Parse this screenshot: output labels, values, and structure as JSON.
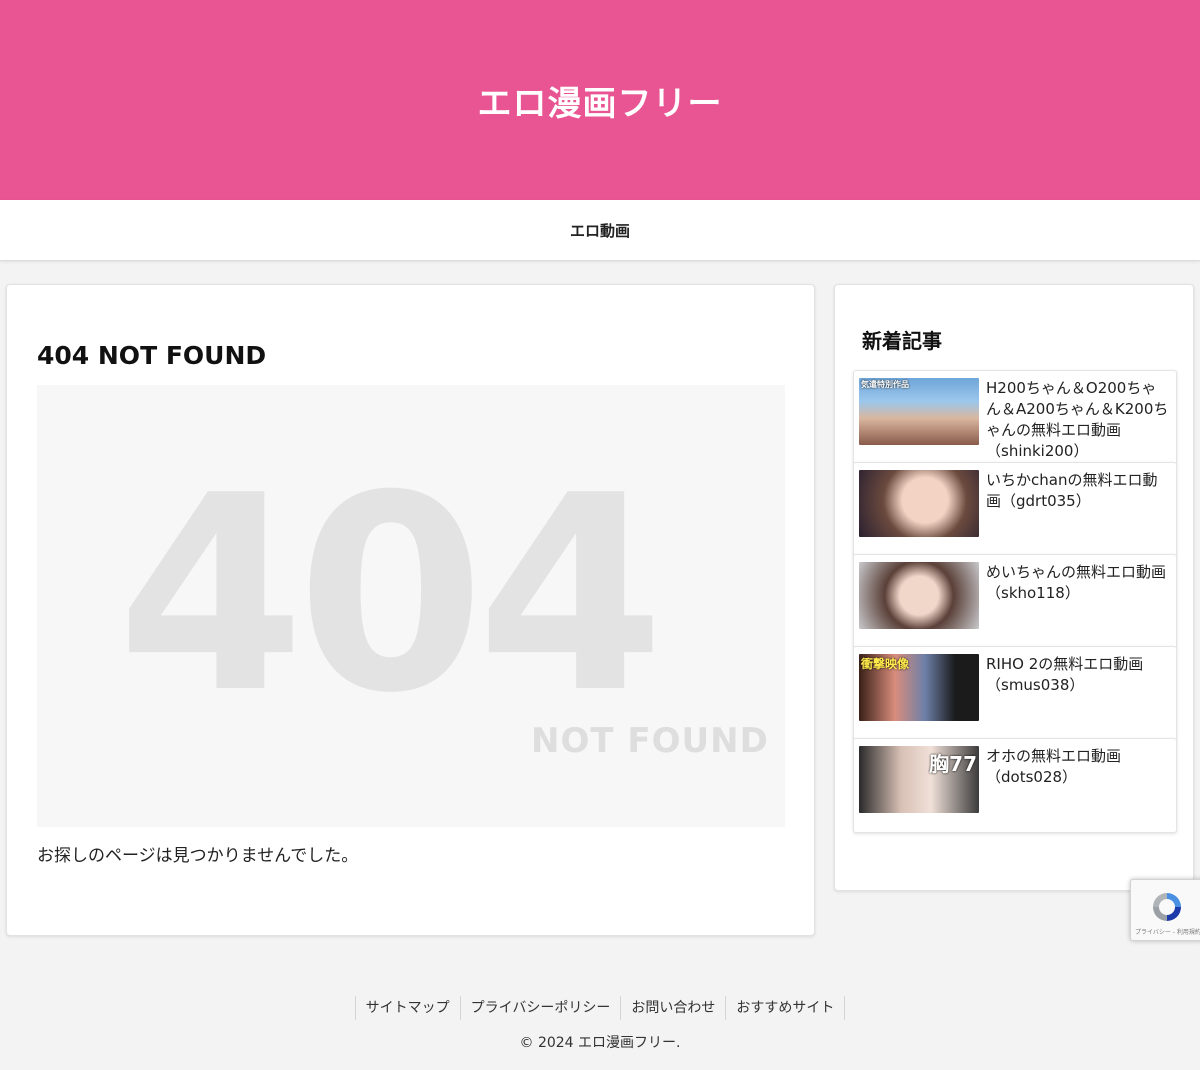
{
  "header": {
    "site_title": "エロ漫画フリー"
  },
  "nav": {
    "items": [
      {
        "label": "エロ動画"
      }
    ]
  },
  "main": {
    "title": "404 NOT FOUND",
    "image_big_text": "404",
    "image_small_text": "NOT FOUND",
    "message": "お探しのページは見つかりませんでした。"
  },
  "sidebar": {
    "title": "新着記事",
    "posts": [
      {
        "title": "H200ちゃん＆O200ちゃん＆A200ちゃん＆K200ちゃんの無料エロ動画（shinki200）",
        "thumb_text": "気遣特別作品"
      },
      {
        "title": "いちかchanの無料エロ動画（gdrt035）",
        "thumb_text": ""
      },
      {
        "title": "めいちゃんの無料エロ動画（skho118）",
        "thumb_text": ""
      },
      {
        "title": "RIHO 2の無料エロ動画（smus038）",
        "thumb_text": "衝撃映像"
      },
      {
        "title": "オホの無料エロ動画（dots028）",
        "thumb_text": "胸77"
      }
    ]
  },
  "footer": {
    "links": [
      {
        "label": "サイトマップ"
      },
      {
        "label": "プライバシーポリシー"
      },
      {
        "label": "お問い合わせ"
      },
      {
        "label": "おすすめサイト"
      }
    ],
    "copyright": "© 2024 エロ漫画フリー."
  },
  "recaptcha": {
    "label": "プライバシー - 利用規約"
  },
  "colors": {
    "accent": "#e85592"
  }
}
